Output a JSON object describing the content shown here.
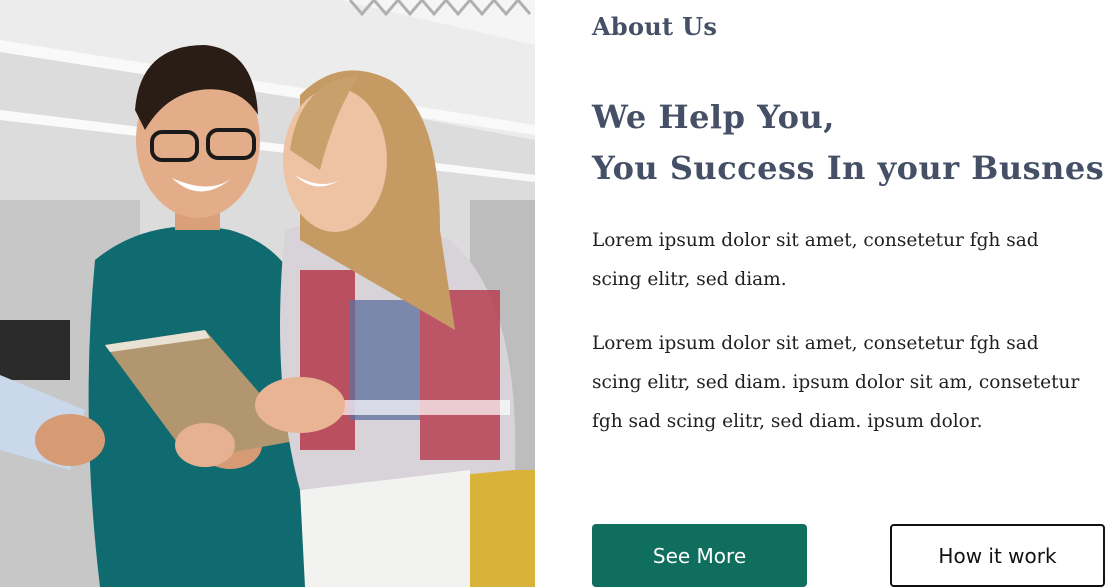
{
  "hero_image": {
    "alt_subject": "two-colleagues-with-tablet-photo"
  },
  "about": {
    "eyebrow": "About Us",
    "headline_line1": "We Help You,",
    "headline_line2": "You Success In your Busness",
    "paragraph1": "Lorem ipsum dolor sit amet, consetetur fgh sad scing elitr, sed diam.",
    "paragraph2": "Lorem ipsum dolor sit amet, consetetur fgh sad scing elitr, sed diam.  ipsum dolor sit am, consetetur fgh sad scing elitr, sed diam.  ipsum dolor."
  },
  "buttons": {
    "primary_label": "See More",
    "secondary_label": "How it work"
  },
  "colors": {
    "heading": "#455066",
    "primary_button": "#0f6e5e",
    "body_text": "#1f1f1f"
  }
}
